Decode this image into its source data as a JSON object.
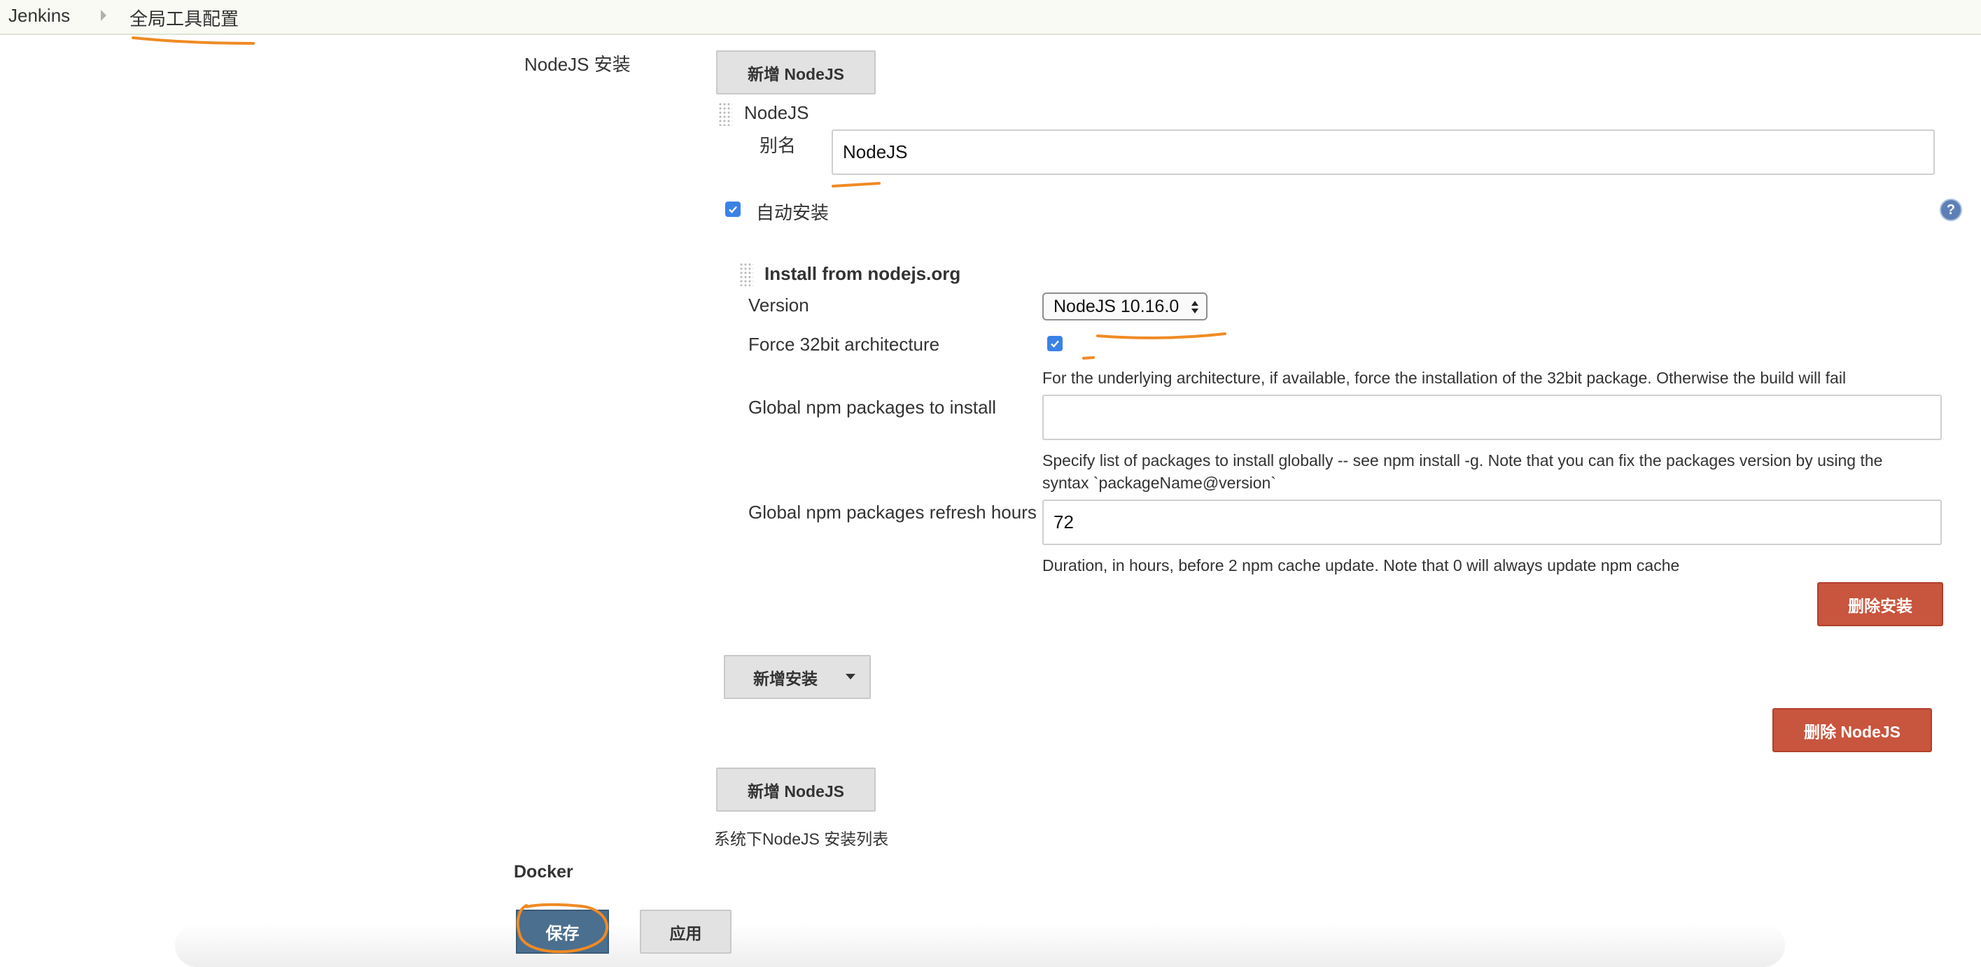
{
  "breadcrumb": {
    "home": "Jenkins",
    "current": "全局工具配置"
  },
  "nodejs": {
    "section_label": "NodeJS 安装",
    "add_button": "新增 NodeJS",
    "item_header": "NodeJS",
    "alias_label": "别名",
    "alias_value": "NodeJS",
    "auto_install_label": "自动安装",
    "installer": {
      "title": "Install from nodejs.org",
      "version_label": "Version",
      "version_value": "NodeJS 10.16.0",
      "force32_label": "Force 32bit architecture",
      "force32_desc": "For the underlying architecture, if available, force the installation of the 32bit package. Otherwise the build will fail",
      "npm_packages_label": "Global npm packages to install",
      "npm_packages_value": "",
      "npm_packages_desc_line1": "Specify list of packages to install globally -- see npm install -g. Note that you can fix the packages version by using the",
      "npm_packages_desc_line2": "syntax `packageName@version`",
      "refresh_label": "Global npm packages refresh hours",
      "refresh_value": "72",
      "refresh_desc": "Duration, in hours, before 2 npm cache update. Note that 0 will always update npm cache",
      "delete_install_button": "删除安装"
    },
    "add_installer_button": "新增安装",
    "delete_nodejs_button": "删除 NodeJS",
    "add_button_2": "新增 NodeJS",
    "list_desc": "系统下NodeJS 安装列表"
  },
  "docker": {
    "section_label": "Docker"
  },
  "footer": {
    "save": "保存",
    "apply": "应用"
  },
  "icons": {
    "help": "help-icon",
    "drag": "drag-handle-icon",
    "checkbox": "checkmark-icon",
    "dropdown": "caret-down-icon",
    "select": "select-arrows-icon",
    "breadcrumb_sep": "chevron-right-icon"
  },
  "colors": {
    "checkbox": "#3a82e6",
    "delete": "#c8553d",
    "save": "#4b6f8f",
    "annotation": "#f08a24"
  }
}
